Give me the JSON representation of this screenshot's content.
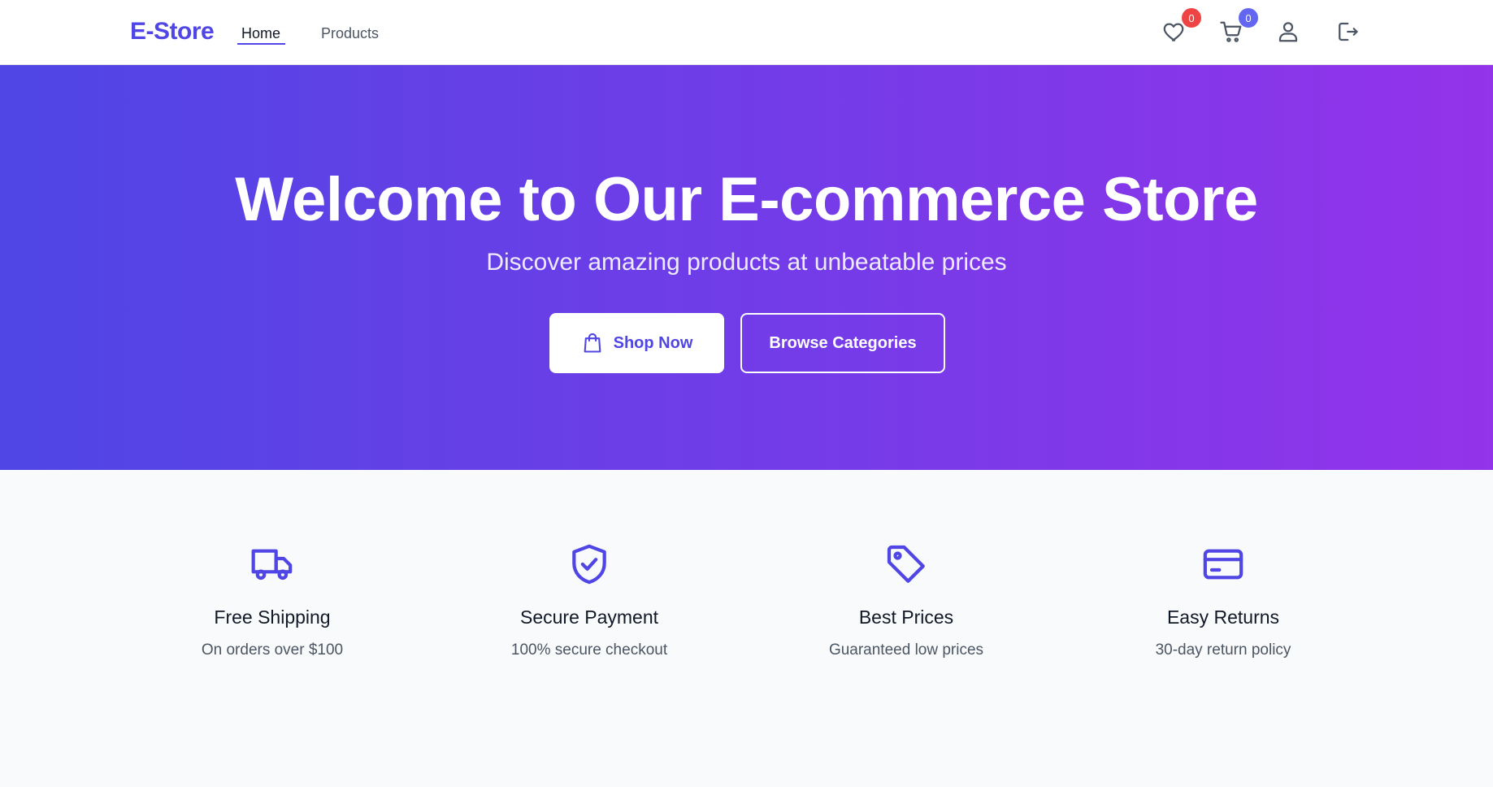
{
  "header": {
    "logo": "E-Store",
    "nav": [
      {
        "label": "Home",
        "active": true
      },
      {
        "label": "Products",
        "active": false
      }
    ],
    "wishlist_count": "0",
    "cart_count": "0",
    "icons": [
      "heart-icon",
      "cart-icon",
      "user-icon",
      "logout-icon"
    ]
  },
  "hero": {
    "title": "Welcome to Our E-commerce Store",
    "subtitle": "Discover amazing products at unbeatable prices",
    "primary_button": "Shop Now",
    "secondary_button": "Browse Categories"
  },
  "features": [
    {
      "icon": "truck-icon",
      "title": "Free Shipping",
      "description": "On orders over $100"
    },
    {
      "icon": "shield-check-icon",
      "title": "Secure Payment",
      "description": "100% secure checkout"
    },
    {
      "icon": "tag-icon",
      "title": "Best Prices",
      "description": "Guaranteed low prices"
    },
    {
      "icon": "credit-card-icon",
      "title": "Easy Returns",
      "description": "30-day return policy"
    }
  ],
  "colors": {
    "brand": "#4f46e5",
    "hero_gradient_start": "#4f46e5",
    "hero_gradient_end": "#9333ea",
    "wishlist_badge": "#ef4444",
    "cart_badge": "#6366f1"
  }
}
